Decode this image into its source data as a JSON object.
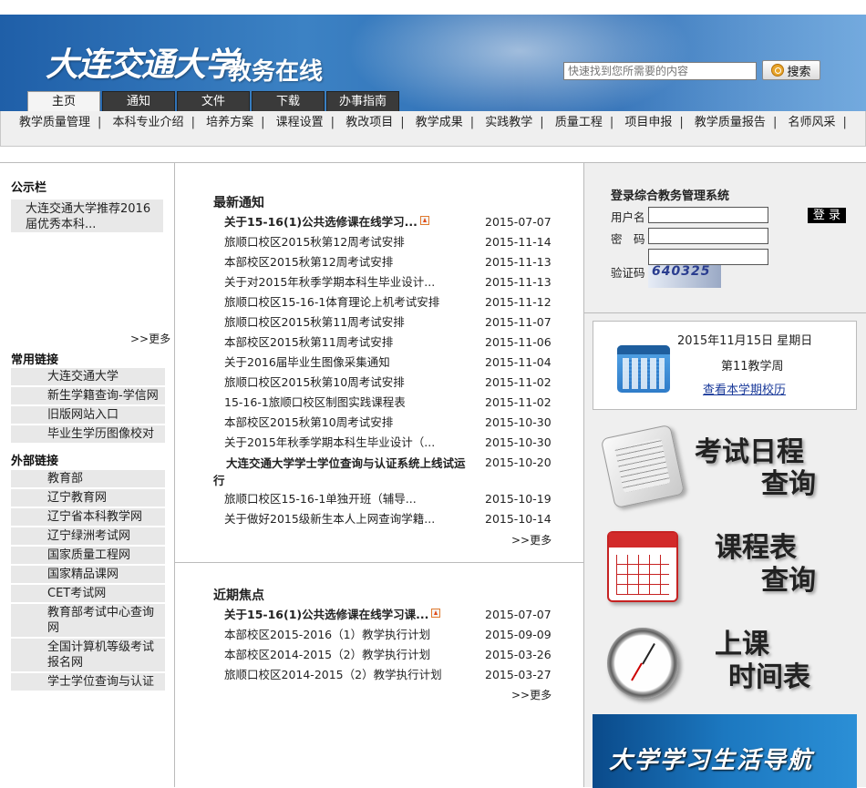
{
  "header": {
    "logo_calligraphy": "大连交通大学",
    "logo_subtitle": "教务在线",
    "search_placeholder": "快速找到您所需要的内容",
    "search_button": "搜索",
    "tabs": [
      {
        "label": "主页",
        "active": true
      },
      {
        "label": "通知",
        "active": false
      },
      {
        "label": "文件",
        "active": false
      },
      {
        "label": "下载",
        "active": false
      },
      {
        "label": "办事指南",
        "active": false
      }
    ]
  },
  "subnav": {
    "items": [
      "教学质量管理",
      "本科专业介绍",
      "培养方案",
      "课程设置",
      "教改项目",
      "教学成果",
      "实践教学",
      "质量工程",
      "项目申报",
      "教学质量报告",
      "名师风采"
    ]
  },
  "left": {
    "notice_title": "公示栏",
    "notice_item": "大连交通大学推荐2016届优秀本科...",
    "notice_more": ">>更多",
    "links_title": "常用链接",
    "links": [
      "大连交通大学",
      "新生学籍查询-学信网",
      "旧版网站入口",
      "毕业生学历图像校对"
    ],
    "ext_title": "外部链接",
    "ext_links": [
      "教育部",
      "辽宁教育网",
      "辽宁省本科教学网",
      "辽宁绿洲考试网",
      "国家质量工程网",
      "国家精品课网",
      "CET考试网",
      "教育部考试中心查询网",
      "全国计算机等级考试报名网",
      "学士学位查询与认证"
    ]
  },
  "news": {
    "title": "最新通知",
    "more": ">>更多",
    "items": [
      {
        "title": "关于15-16(1)公共选修课在线学习...",
        "date": "2015-07-07",
        "bold": true,
        "hot": true
      },
      {
        "title": "旅顺口校区2015秋第12周考试安排",
        "date": "2015-11-14"
      },
      {
        "title": "本部校区2015秋第12周考试安排",
        "date": "2015-11-13"
      },
      {
        "title": "关于对2015年秋季学期本科生毕业设计...",
        "date": "2015-11-13"
      },
      {
        "title": "旅顺口校区15-16-1体育理论上机考试安排",
        "date": "2015-11-12"
      },
      {
        "title": "旅顺口校区2015秋第11周考试安排",
        "date": "2015-11-07"
      },
      {
        "title": "本部校区2015秋第11周考试安排",
        "date": "2015-11-06"
      },
      {
        "title": "关于2016届毕业生图像采集通知",
        "date": "2015-11-04"
      },
      {
        "title": "旅顺口校区2015秋第10周考试安排",
        "date": "2015-11-02"
      },
      {
        "title": "15-16-1旅顺口校区制图实践课程表",
        "date": "2015-11-02"
      },
      {
        "title": "本部校区2015秋第10周考试安排",
        "date": "2015-10-30"
      },
      {
        "title": "关于2015年秋季学期本科生毕业设计（...",
        "date": "2015-10-30"
      },
      {
        "title": "大连交通大学学士学位查询与认证系统上线试运行",
        "date": "2015-10-20",
        "bold": true,
        "wrap": true
      },
      {
        "title": "旅顺口校区15-16-1单独开班（辅导...",
        "date": "2015-10-19"
      },
      {
        "title": "关于做好2015级新生本人上网查询学籍...",
        "date": "2015-10-14"
      }
    ]
  },
  "focus": {
    "title": "近期焦点",
    "more": ">>更多",
    "items": [
      {
        "title": "关于15-16(1)公共选修课在线学习课...",
        "date": "2015-07-07",
        "bold": true,
        "hot": true
      },
      {
        "title": "本部校区2015-2016（1）教学执行计划",
        "date": "2015-09-09"
      },
      {
        "title": "本部校区2014-2015（2）教学执行计划",
        "date": "2015-03-26"
      },
      {
        "title": "旅顺口校区2014-2015（2）教学执行计划",
        "date": "2015-03-27"
      }
    ]
  },
  "login": {
    "title": "登录综合教务管理系统",
    "username_label": "用户名",
    "password_label": "密　码",
    "captcha_label": "验证码",
    "login_button": "登 录",
    "captcha_text": "640325"
  },
  "date_box": {
    "date": "2015年11月15日 星期日",
    "week": "第11教学周",
    "calendar_link": "查看本学期校历"
  },
  "quick_links": {
    "exam_line1": "考试日程",
    "exam_line2": "查询",
    "course_line1": "课程表",
    "course_line2": "查询",
    "time_line1": "上课",
    "time_line2": "时间表"
  },
  "banner": {
    "text": "大学学习生活导航"
  }
}
